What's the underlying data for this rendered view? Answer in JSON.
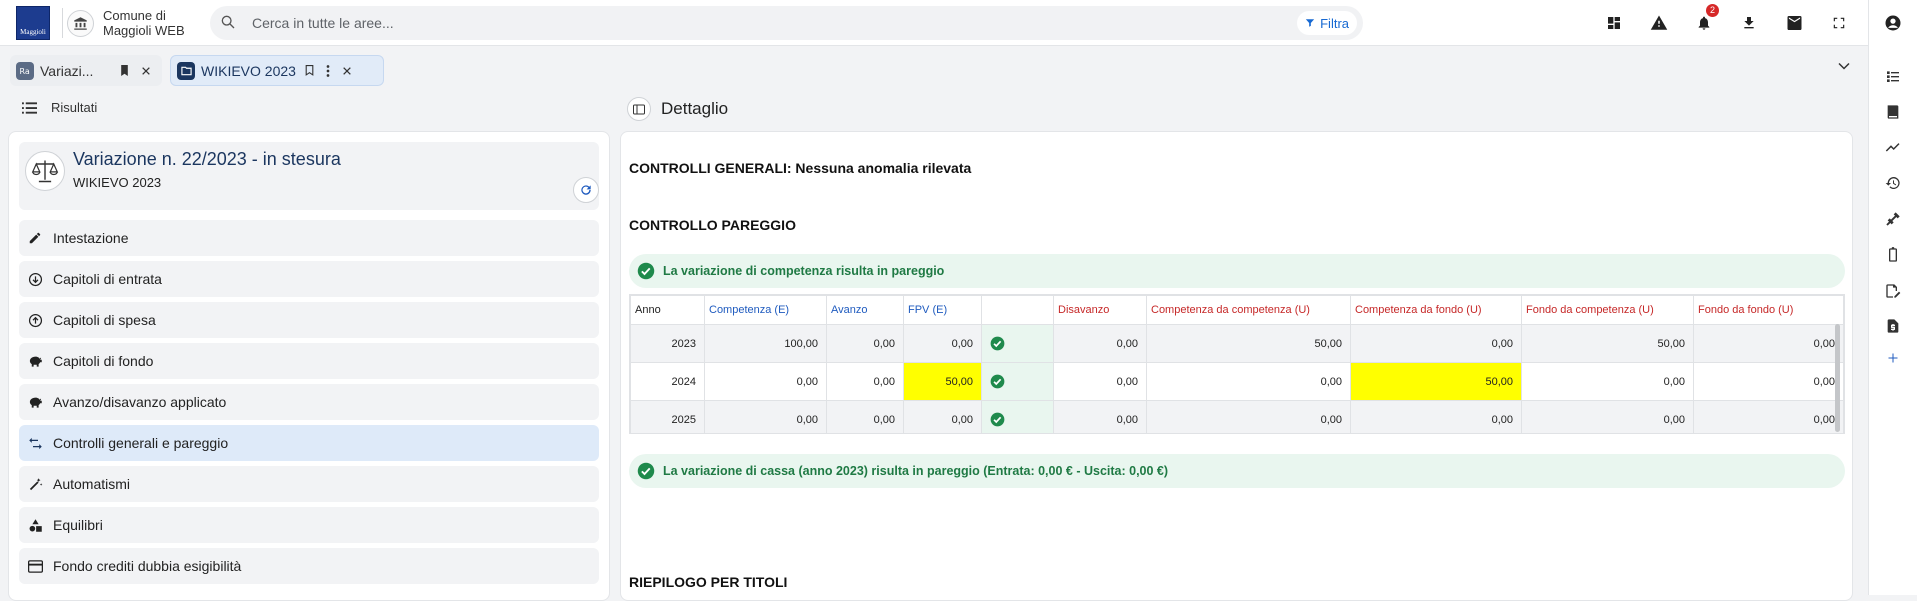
{
  "app": {
    "logo_text": "Maggioli",
    "name": "Comune di Maggioli WEB",
    "search_placeholder": "Cerca in tutte le aree...",
    "filter_label": "Filtra",
    "notification_count": "2"
  },
  "tabs": [
    {
      "label": "Variazi...",
      "icon": "ra-icon"
    },
    {
      "label": "WIKIEVO 2023",
      "icon": "folder-icon"
    }
  ],
  "left": {
    "header": "Risultati",
    "card_title": "Variazione n. 22/2023 - in stesura",
    "card_subtitle": "WIKIEVO 2023",
    "menu": [
      {
        "label": "Intestazione",
        "icon": "pencil-icon"
      },
      {
        "label": "Capitoli di entrata",
        "icon": "arrow-down-circle-icon"
      },
      {
        "label": "Capitoli di spesa",
        "icon": "arrow-up-circle-icon"
      },
      {
        "label": "Capitoli di fondo",
        "icon": "piggy-bank-icon"
      },
      {
        "label": "Avanzo/disavanzo applicato",
        "icon": "piggy-bank-icon"
      },
      {
        "label": "Controlli generali e pareggio",
        "icon": "transfer-icon",
        "active": true
      },
      {
        "label": "Automatismi",
        "icon": "magic-wand-icon"
      },
      {
        "label": "Equilibri",
        "icon": "shapes-icon"
      },
      {
        "label": "Fondo crediti dubbia esigibilità",
        "icon": "credit-card-icon"
      }
    ]
  },
  "detail": {
    "header": "Dettaglio",
    "controlli_generali": "CONTROLLI GENERALI: Nessuna anomalia rilevata",
    "controllo_pareggio": "CONTROLLO PAREGGIO",
    "competenza_ok": "La variazione di competenza risulta in pareggio",
    "cassa_ok": "La variazione di cassa (anno 2023) risulta in pareggio (Entrata: 0,00 € - Uscita: 0,00 €)",
    "riepilogo": "RIEPILOGO PER TITOLI",
    "table": {
      "headers": [
        "Anno",
        "Competenza (E)",
        "Avanzo",
        "FPV (E)",
        "",
        "Disavanzo",
        "Competenza da competenza (U)",
        "Competenza da fondo (U)",
        "Fondo da competenza (U)",
        "Fondo da fondo (U)"
      ],
      "rows": [
        {
          "anno": "2023",
          "competenza_e": "100,00",
          "avanzo": "0,00",
          "fpv_e": "0,00",
          "disavanzo": "0,00",
          "comp_da_comp": "50,00",
          "comp_da_fondo": "0,00",
          "fondo_da_comp": "50,00",
          "fondo_da_fondo": "0,00"
        },
        {
          "anno": "2024",
          "competenza_e": "0,00",
          "avanzo": "0,00",
          "fpv_e": "50,00",
          "disavanzo": "0,00",
          "comp_da_comp": "0,00",
          "comp_da_fondo": "50,00",
          "fondo_da_comp": "0,00",
          "fondo_da_fondo": "0,00"
        },
        {
          "anno": "2025",
          "competenza_e": "0,00",
          "avanzo": "0,00",
          "fpv_e": "0,00",
          "disavanzo": "0,00",
          "comp_da_comp": "0,00",
          "comp_da_fondo": "0,00",
          "fondo_da_comp": "0,00",
          "fondo_da_fondo": "0,00"
        }
      ]
    }
  }
}
